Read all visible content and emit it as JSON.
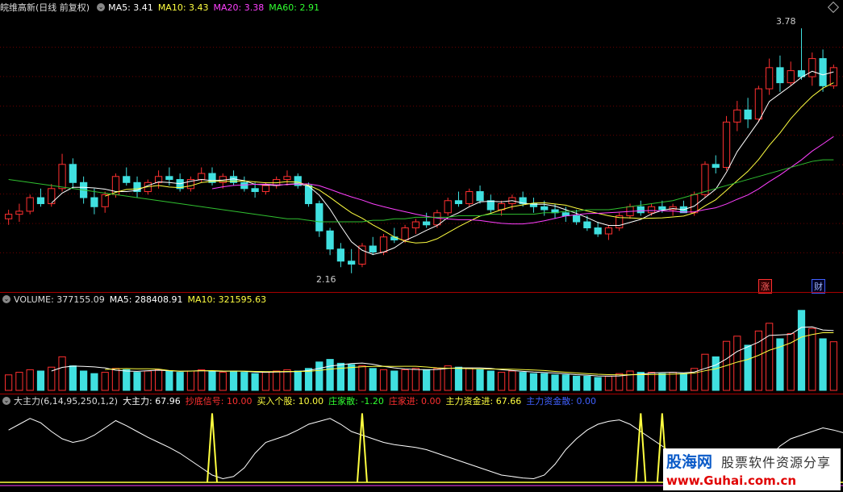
{
  "price_pane": {
    "title": "皖维高新(日线 前复权)",
    "ma5": "MA5: 3.41",
    "ma10": "MA10: 3.43",
    "ma20": "MA20: 3.38",
    "ma60": "MA60: 2.91",
    "high_label": "3.78",
    "low_label": "2.16",
    "badge_zhang": "涨",
    "badge_cai": "财"
  },
  "volume_pane": {
    "title": "VOLUME: 377155.09",
    "ma5": "MA5: 288408.91",
    "ma10": "MA10: 321595.63"
  },
  "indicator_pane": {
    "title": "大主力(6,14,95,250,1,2)",
    "items": [
      {
        "text": "大主力: 67.96",
        "color": "#ffffff"
      },
      {
        "text": "抄底信号: 10.00",
        "color": "#ff3030"
      },
      {
        "text": "买入个股: 10.00",
        "color": "#ffff40"
      },
      {
        "text": "庄家散: -1.20",
        "color": "#30ff30"
      },
      {
        "text": "庄家进: 0.00",
        "color": "#ff3030"
      },
      {
        "text": "主力资金进: 67.66",
        "color": "#ffff40"
      },
      {
        "text": "主力资金散: 0.00",
        "color": "#4060ff"
      }
    ]
  },
  "watermark": {
    "line1a": "股海网",
    "line1b": "股票软件资源分享",
    "line2": "www.Guhai.com.cn"
  },
  "colors": {
    "up": "#ff3030",
    "down": "#40e0e0",
    "ma5": "#ffffff",
    "ma10": "#ffff40",
    "ma20": "#ff40ff",
    "ma60": "#30c030",
    "grid": "#a80000"
  },
  "chart_data": {
    "type": "candlestick",
    "ohlc": [
      [
        2.52,
        2.58,
        2.48,
        2.55
      ],
      [
        2.55,
        2.62,
        2.5,
        2.57
      ],
      [
        2.57,
        2.68,
        2.55,
        2.66
      ],
      [
        2.66,
        2.72,
        2.6,
        2.62
      ],
      [
        2.62,
        2.75,
        2.6,
        2.72
      ],
      [
        2.72,
        2.95,
        2.7,
        2.88
      ],
      [
        2.88,
        2.92,
        2.72,
        2.76
      ],
      [
        2.76,
        2.8,
        2.62,
        2.66
      ],
      [
        2.66,
        2.72,
        2.55,
        2.6
      ],
      [
        2.6,
        2.7,
        2.56,
        2.68
      ],
      [
        2.68,
        2.82,
        2.66,
        2.8
      ],
      [
        2.8,
        2.86,
        2.74,
        2.76
      ],
      [
        2.76,
        2.8,
        2.66,
        2.7
      ],
      [
        2.7,
        2.78,
        2.68,
        2.76
      ],
      [
        2.76,
        2.84,
        2.72,
        2.8
      ],
      [
        2.8,
        2.86,
        2.74,
        2.78
      ],
      [
        2.78,
        2.82,
        2.7,
        2.72
      ],
      [
        2.72,
        2.8,
        2.7,
        2.78
      ],
      [
        2.78,
        2.86,
        2.76,
        2.82
      ],
      [
        2.82,
        2.86,
        2.74,
        2.76
      ],
      [
        2.76,
        2.82,
        2.72,
        2.8
      ],
      [
        2.8,
        2.84,
        2.74,
        2.76
      ],
      [
        2.76,
        2.8,
        2.7,
        2.72
      ],
      [
        2.72,
        2.76,
        2.66,
        2.7
      ],
      [
        2.7,
        2.76,
        2.68,
        2.74
      ],
      [
        2.74,
        2.8,
        2.72,
        2.78
      ],
      [
        2.78,
        2.84,
        2.74,
        2.8
      ],
      [
        2.8,
        2.82,
        2.72,
        2.74
      ],
      [
        2.74,
        2.76,
        2.6,
        2.62
      ],
      [
        2.62,
        2.64,
        2.4,
        2.44
      ],
      [
        2.44,
        2.46,
        2.28,
        2.32
      ],
      [
        2.32,
        2.36,
        2.2,
        2.24
      ],
      [
        2.24,
        2.32,
        2.16,
        2.22
      ],
      [
        2.22,
        2.36,
        2.2,
        2.34
      ],
      [
        2.34,
        2.4,
        2.28,
        2.3
      ],
      [
        2.3,
        2.42,
        2.28,
        2.4
      ],
      [
        2.4,
        2.46,
        2.36,
        2.38
      ],
      [
        2.38,
        2.48,
        2.36,
        2.46
      ],
      [
        2.46,
        2.52,
        2.42,
        2.5
      ],
      [
        2.5,
        2.56,
        2.46,
        2.48
      ],
      [
        2.48,
        2.58,
        2.46,
        2.56
      ],
      [
        2.56,
        2.66,
        2.54,
        2.64
      ],
      [
        2.64,
        2.7,
        2.6,
        2.62
      ],
      [
        2.62,
        2.72,
        2.6,
        2.7
      ],
      [
        2.7,
        2.74,
        2.62,
        2.64
      ],
      [
        2.64,
        2.68,
        2.56,
        2.58
      ],
      [
        2.58,
        2.64,
        2.54,
        2.62
      ],
      [
        2.62,
        2.68,
        2.58,
        2.66
      ],
      [
        2.66,
        2.7,
        2.6,
        2.62
      ],
      [
        2.62,
        2.66,
        2.56,
        2.6
      ],
      [
        2.6,
        2.64,
        2.54,
        2.58
      ],
      [
        2.58,
        2.62,
        2.52,
        2.56
      ],
      [
        2.56,
        2.6,
        2.5,
        2.54
      ],
      [
        2.54,
        2.58,
        2.48,
        2.5
      ],
      [
        2.5,
        2.54,
        2.44,
        2.46
      ],
      [
        2.46,
        2.5,
        2.4,
        2.42
      ],
      [
        2.42,
        2.48,
        2.38,
        2.46
      ],
      [
        2.46,
        2.56,
        2.44,
        2.54
      ],
      [
        2.54,
        2.62,
        2.52,
        2.6
      ],
      [
        2.6,
        2.64,
        2.54,
        2.56
      ],
      [
        2.56,
        2.62,
        2.54,
        2.6
      ],
      [
        2.6,
        2.64,
        2.56,
        2.58
      ],
      [
        2.58,
        2.62,
        2.54,
        2.6
      ],
      [
        2.6,
        2.64,
        2.56,
        2.56
      ],
      [
        2.56,
        2.7,
        2.54,
        2.68
      ],
      [
        2.68,
        2.9,
        2.66,
        2.88
      ],
      [
        2.88,
        2.94,
        2.82,
        2.86
      ],
      [
        2.86,
        3.2,
        2.84,
        3.16
      ],
      [
        3.16,
        3.3,
        3.1,
        3.24
      ],
      [
        3.24,
        3.32,
        3.12,
        3.18
      ],
      [
        3.18,
        3.4,
        3.16,
        3.38
      ],
      [
        3.38,
        3.58,
        3.34,
        3.52
      ],
      [
        3.52,
        3.6,
        3.36,
        3.42
      ],
      [
        3.42,
        3.56,
        3.4,
        3.5
      ],
      [
        3.5,
        3.78,
        3.44,
        3.46
      ],
      [
        3.46,
        3.62,
        3.4,
        3.58
      ],
      [
        3.58,
        3.64,
        3.36,
        3.4
      ],
      [
        3.4,
        3.54,
        3.38,
        3.52
      ]
    ],
    "ma60": [
      2.78,
      2.77,
      2.76,
      2.75,
      2.74,
      2.73,
      2.72,
      2.71,
      2.7,
      2.69,
      2.68,
      2.67,
      2.66,
      2.65,
      2.64,
      2.63,
      2.62,
      2.61,
      2.6,
      2.59,
      2.58,
      2.57,
      2.56,
      2.55,
      2.54,
      2.53,
      2.52,
      2.52,
      2.51,
      2.5,
      2.5,
      2.5,
      2.5,
      2.5,
      2.51,
      2.51,
      2.52,
      2.52,
      2.53,
      2.53,
      2.53,
      2.53,
      2.54,
      2.54,
      2.54,
      2.55,
      2.55,
      2.55,
      2.55,
      2.55,
      2.56,
      2.56,
      2.57,
      2.57,
      2.58,
      2.58,
      2.58,
      2.59,
      2.6,
      2.61,
      2.62,
      2.63,
      2.64,
      2.66,
      2.68,
      2.7,
      2.72,
      2.74,
      2.76,
      2.78,
      2.8,
      2.82,
      2.84,
      2.86,
      2.88,
      2.9,
      2.91,
      2.91
    ],
    "ylim": [
      2.1,
      3.85
    ],
    "volume": [
      120,
      140,
      160,
      150,
      180,
      260,
      190,
      150,
      130,
      140,
      170,
      160,
      140,
      150,
      160,
      150,
      140,
      150,
      160,
      150,
      140,
      150,
      140,
      130,
      140,
      150,
      160,
      150,
      170,
      220,
      240,
      210,
      200,
      190,
      170,
      160,
      150,
      160,
      170,
      160,
      170,
      190,
      180,
      170,
      160,
      150,
      140,
      150,
      140,
      130,
      130,
      120,
      120,
      110,
      110,
      100,
      110,
      130,
      150,
      140,
      140,
      130,
      140,
      130,
      170,
      280,
      260,
      380,
      420,
      350,
      460,
      520,
      400,
      440,
      620,
      480,
      400,
      377
    ],
    "volume_ylim": [
      0,
      650
    ],
    "indicator": [
      72,
      80,
      88,
      82,
      70,
      60,
      55,
      58,
      65,
      75,
      85,
      78,
      70,
      62,
      55,
      48,
      40,
      30,
      20,
      10,
      5,
      8,
      20,
      40,
      55,
      60,
      65,
      72,
      80,
      84,
      88,
      80,
      70,
      65,
      60,
      55,
      52,
      50,
      48,
      45,
      40,
      35,
      30,
      25,
      20,
      15,
      10,
      8,
      6,
      5,
      10,
      25,
      45,
      60,
      72,
      80,
      84,
      86,
      80,
      70,
      60,
      50,
      40,
      30,
      22,
      15,
      10,
      5,
      4,
      8,
      20,
      35,
      50,
      60,
      65,
      70,
      75,
      72,
      67.96
    ],
    "indicator_signals": [
      19,
      33,
      59,
      61
    ],
    "indicator_ylim": [
      0,
      100
    ]
  }
}
